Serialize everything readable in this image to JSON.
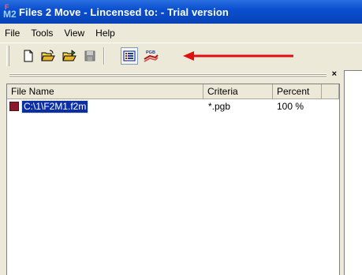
{
  "window": {
    "title": "Files 2 Move - Lincensed to:  - Trial version",
    "app_icon_sup": "F",
    "app_icon_main": "M2"
  },
  "menu": [
    {
      "label": "File"
    },
    {
      "label": "Tools"
    },
    {
      "label": "View"
    },
    {
      "label": "Help"
    }
  ],
  "toolbar": {
    "buttons": [
      "new-icon",
      "open-icon",
      "open-folder-icon",
      "save-icon",
      "list-view-icon",
      "pgb-icon"
    ],
    "pgb_label": "PGB",
    "arrow_color": "#e01010"
  },
  "panel": {
    "close_label": "×"
  },
  "list": {
    "columns": [
      "File Name",
      "Criteria",
      "Percent"
    ],
    "rows": [
      {
        "file": "C:\\1\\F2M1.f2m",
        "criteria": "*.pgb",
        "percent": "100 %"
      }
    ]
  },
  "colors": {
    "title_bar": "#0a4fd0",
    "selection": "#0a2ea3",
    "file_icon": "#8b1a2e"
  }
}
